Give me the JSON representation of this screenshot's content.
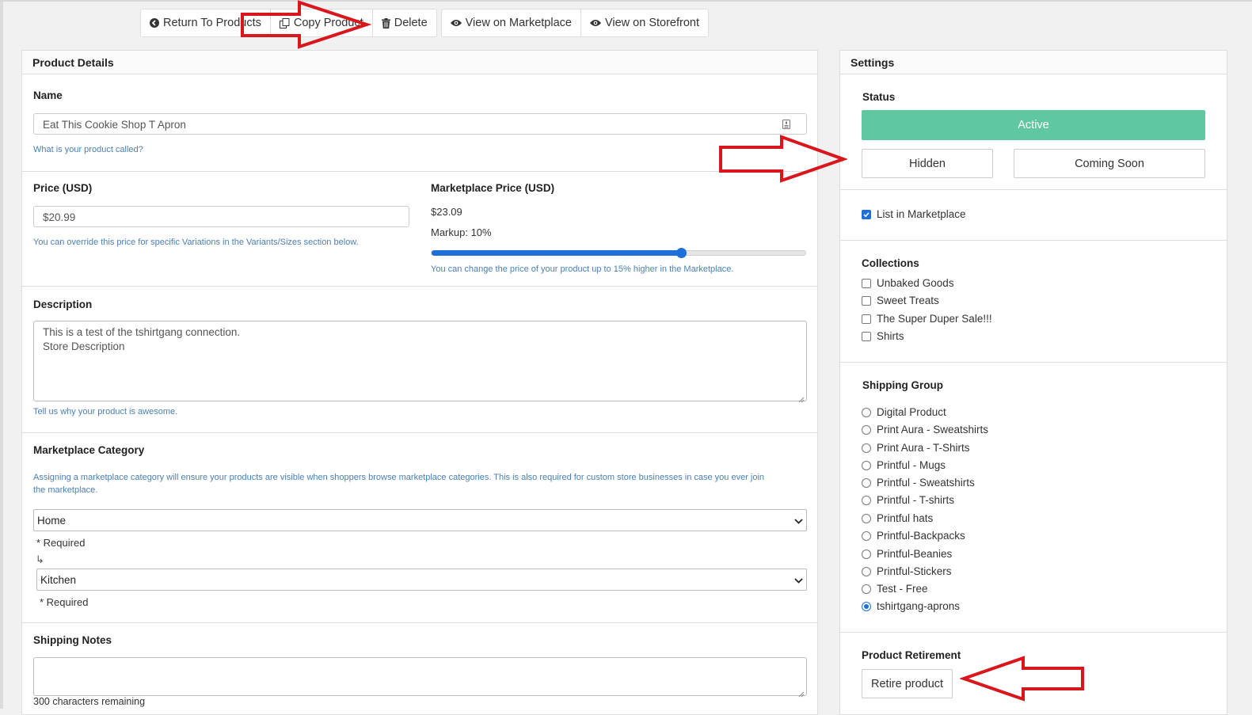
{
  "toolbar": {
    "return_label": "Return To Products",
    "copy_label": "Copy Product",
    "delete_label": "Delete",
    "view_marketplace_label": "View on Marketplace",
    "view_storefront_label": "View on Storefront"
  },
  "product_details": {
    "title": "Product Details",
    "name": {
      "label": "Name",
      "value": "Eat This Cookie Shop T Apron",
      "help": "What is your product called?"
    },
    "price": {
      "label": "Price (USD)",
      "value": "$20.99",
      "help": "You can override this price for specific Variations in the Variants/Sizes section below."
    },
    "marketplace_price": {
      "label": "Marketplace Price (USD)",
      "value": "$23.09",
      "markup_text": "Markup: 10%",
      "markup_fraction": 0.667,
      "help": "You can change the price of your product up to 15% higher in the Marketplace."
    },
    "description": {
      "label": "Description",
      "line1": "This is a test of the tshirtgang connection.",
      "line2": "Store Description",
      "help": "Tell us why your product is awesome."
    },
    "category": {
      "label": "Marketplace Category",
      "help": "Assigning a marketplace category will ensure your products are visible when shoppers browse marketplace categories. This is also required for custom store businesses in case you ever join the marketplace.",
      "primary": "Home",
      "required_text": "* Required",
      "sub_arrow": "↳",
      "secondary": "Kitchen"
    },
    "shipping_notes": {
      "label": "Shipping Notes",
      "value": "",
      "remaining": "300 characters remaining"
    }
  },
  "settings": {
    "title": "Settings",
    "status": {
      "label": "Status",
      "active": "Active",
      "hidden": "Hidden",
      "coming_soon": "Coming Soon"
    },
    "list_in_marketplace": "List in Marketplace",
    "collections": {
      "label": "Collections",
      "items": [
        "Unbaked Goods",
        "Sweet Treats",
        "The Super Duper Sale!!!",
        "Shirts"
      ]
    },
    "shipping_group": {
      "label": "Shipping Group",
      "items": [
        "Digital Product",
        "Print Aura - Sweatshirts",
        "Print Aura - T-Shirts",
        "Printful - Mugs",
        "Printful - Sweatshirts",
        "Printful - T-shirts",
        "Printful hats",
        "Printful-Backpacks",
        "Printful-Beanies",
        "Printful-Stickers",
        "Test - Free",
        "tshirtgang-aprons"
      ],
      "selected": "tshirtgang-aprons"
    },
    "retirement": {
      "label": "Product Retirement",
      "button": "Retire product"
    }
  },
  "colors": {
    "active_green": "#5fc8a0",
    "accent_blue": "#1e6fd9",
    "help_blue": "#4a7fb5",
    "annotation_red": "#d9161c"
  }
}
